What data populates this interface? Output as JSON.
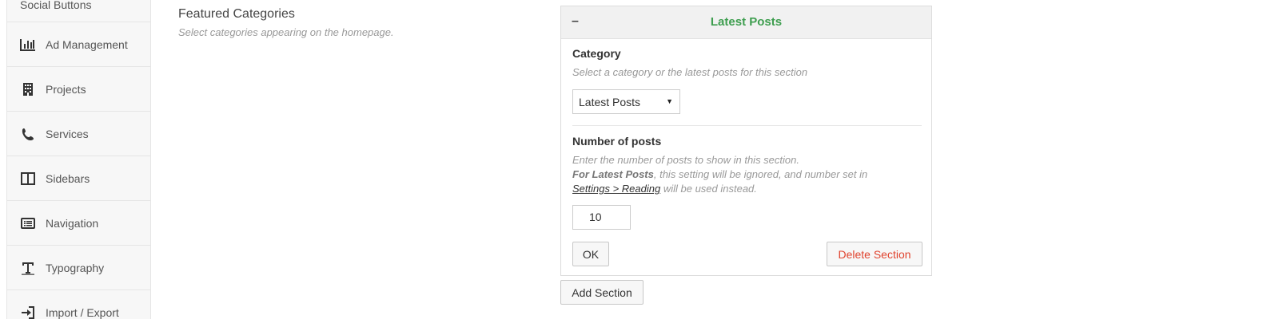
{
  "sidebar": {
    "items": [
      {
        "label": "Social Buttons",
        "icon": "share-icon"
      },
      {
        "label": "Ad Management",
        "icon": "bar-chart-icon"
      },
      {
        "label": "Projects",
        "icon": "building-icon"
      },
      {
        "label": "Services",
        "icon": "phone-icon"
      },
      {
        "label": "Sidebars",
        "icon": "columns-icon"
      },
      {
        "label": "Navigation",
        "icon": "list-alt-icon"
      },
      {
        "label": "Typography",
        "icon": "text-height-icon"
      },
      {
        "label": "Import / Export",
        "icon": "sign-in-icon"
      }
    ]
  },
  "field": {
    "title": "Featured Categories",
    "description": "Select categories appearing on the homepage."
  },
  "section": {
    "toggle": "–",
    "title": "Latest Posts",
    "category_label": "Category",
    "category_hint": "Select a category or the latest posts for this section",
    "category_selected": "Latest Posts",
    "posts_label": "Number of posts",
    "posts_hint_line1": "Enter the number of posts to show in this section.",
    "posts_hint_bold": "For Latest Posts",
    "posts_hint_rest": ", this setting will be ignored, and number set in",
    "posts_hint_link": "Settings > Reading",
    "posts_hint_end": " will be used instead.",
    "posts_value": "10",
    "ok_label": "OK",
    "delete_label": "Delete Section"
  },
  "add_section_label": "Add Section",
  "colors": {
    "section_title": "#3e9e4f",
    "delete_text": "#e0432e"
  }
}
